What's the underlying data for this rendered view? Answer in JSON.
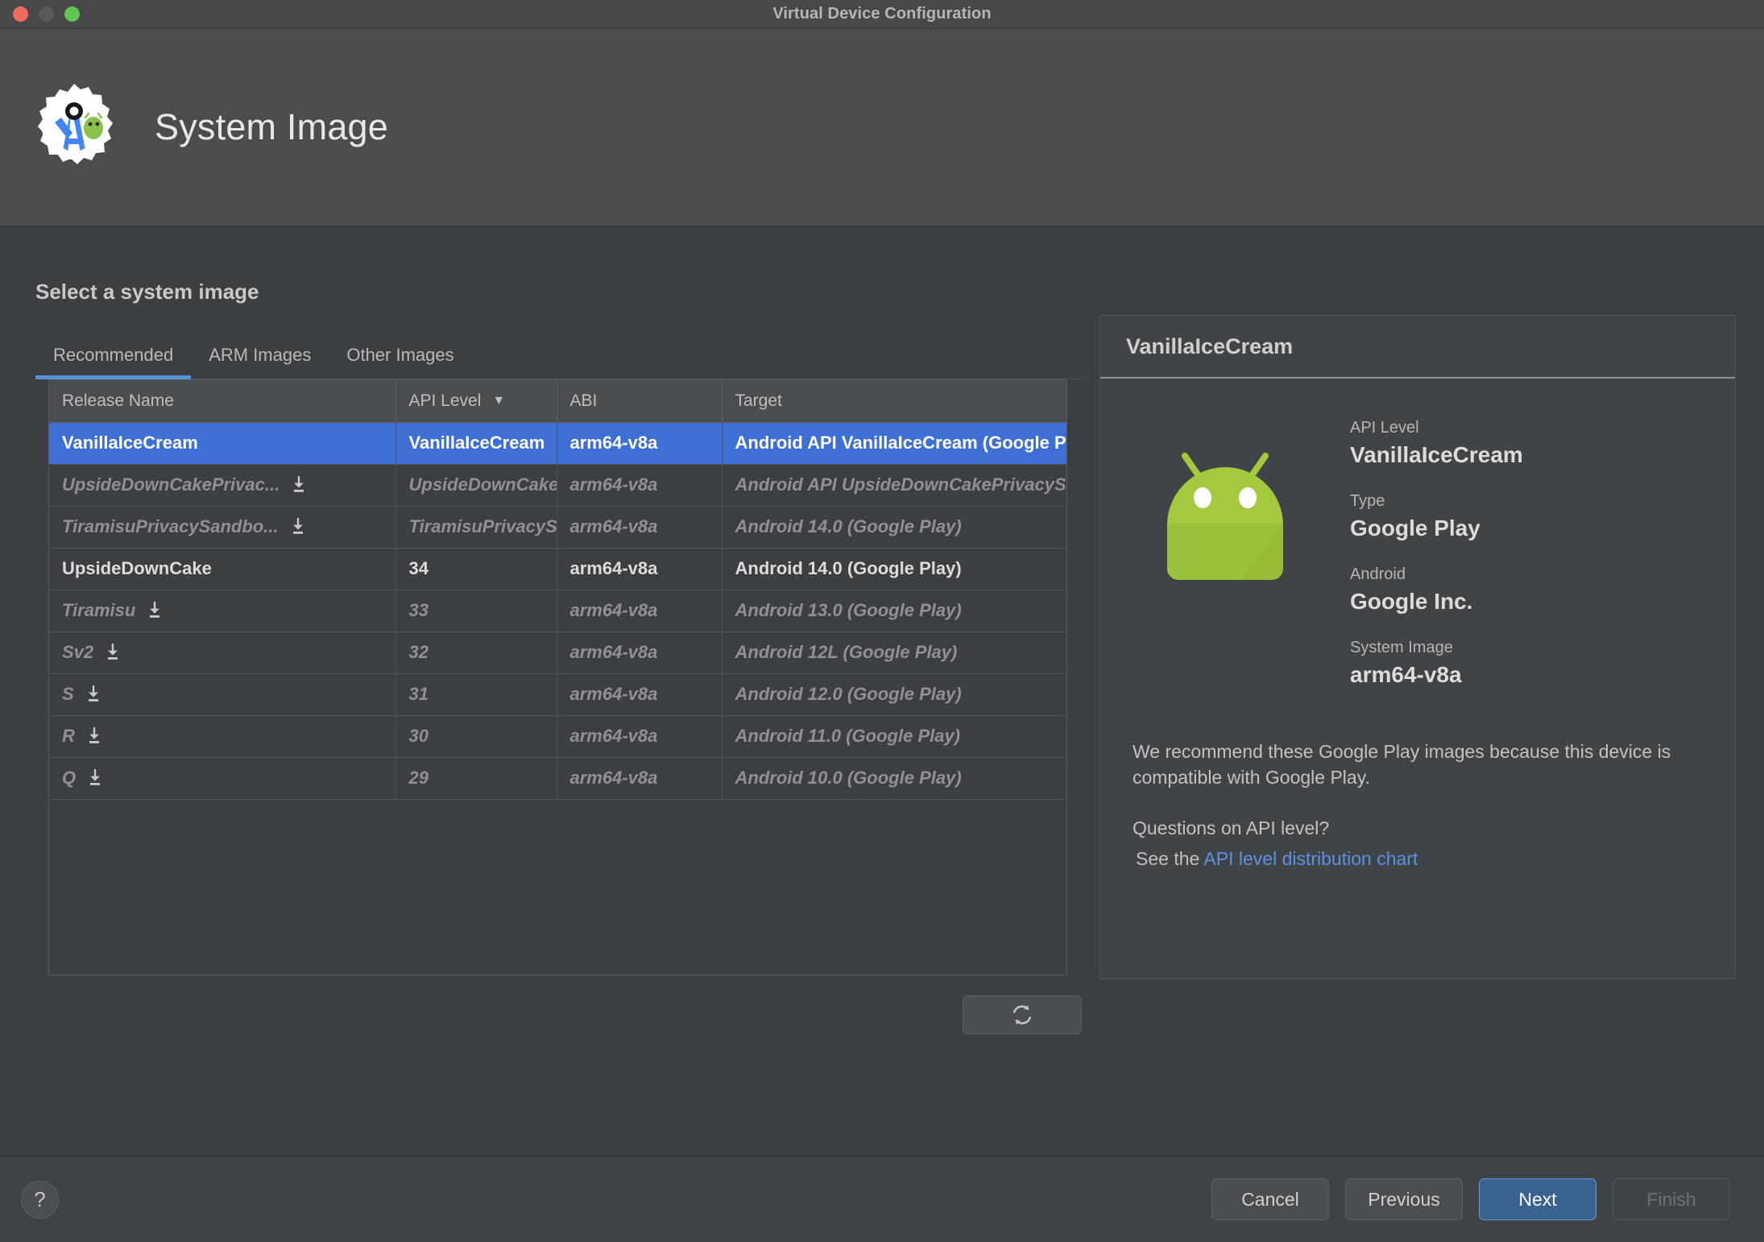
{
  "window": {
    "title": "Virtual Device Configuration",
    "traffic_lights": [
      "close-red",
      "minimize-gray",
      "maximize-green"
    ]
  },
  "wizard": {
    "logo_icon": "android-studio-icon",
    "title": "System Image"
  },
  "main": {
    "section_title": "Select a system image",
    "tabs": [
      {
        "label": "Recommended",
        "active": true
      },
      {
        "label": "ARM Images",
        "active": false
      },
      {
        "label": "Other Images",
        "active": false
      }
    ],
    "table": {
      "columns": [
        {
          "label": "Release Name",
          "sorted": false
        },
        {
          "label": "API Level",
          "sorted": true,
          "sort_icon": "chevron-down-icon"
        },
        {
          "label": "ABI",
          "sorted": false
        },
        {
          "label": "Target",
          "sorted": false
        }
      ],
      "rows": [
        {
          "release_name": "VanillaIceCream",
          "api_level": "VanillaIceCream",
          "abi": "arm64-v8a",
          "target": "Android API VanillaIceCream (Google Play)",
          "state": "selected",
          "download": false
        },
        {
          "release_name": "UpsideDownCakePrivac...",
          "api_level": "UpsideDownCakePrivacySandbox",
          "abi": "arm64-v8a",
          "target": "Android API UpsideDownCakePrivacySandbox (Google Play)",
          "state": "download",
          "download": true
        },
        {
          "release_name": "TiramisuPrivacySandbo...",
          "api_level": "TiramisuPrivacySandbox",
          "abi": "arm64-v8a",
          "target": "Android 14.0 (Google Play)",
          "state": "download",
          "download": true
        },
        {
          "release_name": "UpsideDownCake",
          "api_level": "34",
          "abi": "arm64-v8a",
          "target": "Android 14.0 (Google Play)",
          "state": "installed",
          "download": false
        },
        {
          "release_name": "Tiramisu",
          "api_level": "33",
          "abi": "arm64-v8a",
          "target": "Android 13.0 (Google Play)",
          "state": "download",
          "download": true
        },
        {
          "release_name": "Sv2",
          "api_level": "32",
          "abi": "arm64-v8a",
          "target": "Android 12L (Google Play)",
          "state": "download",
          "download": true
        },
        {
          "release_name": "S",
          "api_level": "31",
          "abi": "arm64-v8a",
          "target": "Android 12.0 (Google Play)",
          "state": "download",
          "download": true
        },
        {
          "release_name": "R",
          "api_level": "30",
          "abi": "arm64-v8a",
          "target": "Android 11.0 (Google Play)",
          "state": "download",
          "download": true
        },
        {
          "release_name": "Q",
          "api_level": "29",
          "abi": "arm64-v8a",
          "target": "Android 10.0 (Google Play)",
          "state": "download",
          "download": true
        }
      ]
    },
    "refresh_button": {
      "icon": "refresh-icon",
      "label": ""
    }
  },
  "detail": {
    "header_title": "VanillaIceCream",
    "image_icon": "android-robot-icon",
    "facts": [
      {
        "label": "API Level",
        "value": "VanillaIceCream"
      },
      {
        "label": "Type",
        "value": "Google Play"
      },
      {
        "label": "Android",
        "value": "Google Inc."
      },
      {
        "label": "System Image",
        "value": "arm64-v8a"
      }
    ],
    "note": "We recommend these Google Play images because this device is compatible with Google Play.",
    "question": "Questions on API level?",
    "see_the": "See the",
    "link_label": "API level distribution chart"
  },
  "footer": {
    "help_label": "?",
    "buttons": [
      {
        "label": "Cancel",
        "kind": "normal"
      },
      {
        "label": "Previous",
        "kind": "normal"
      },
      {
        "label": "Next",
        "kind": "primary"
      },
      {
        "label": "Finish",
        "kind": "disabled"
      }
    ]
  },
  "colors": {
    "accent_blue": "#3d6fd4",
    "tab_underline": "#5890d6",
    "link_blue": "#5b91e0",
    "primary_button": "#3a628f",
    "android_green": "#a4c639",
    "window_bg": "#3c3f41",
    "header_bg": "#4c4c4e"
  }
}
